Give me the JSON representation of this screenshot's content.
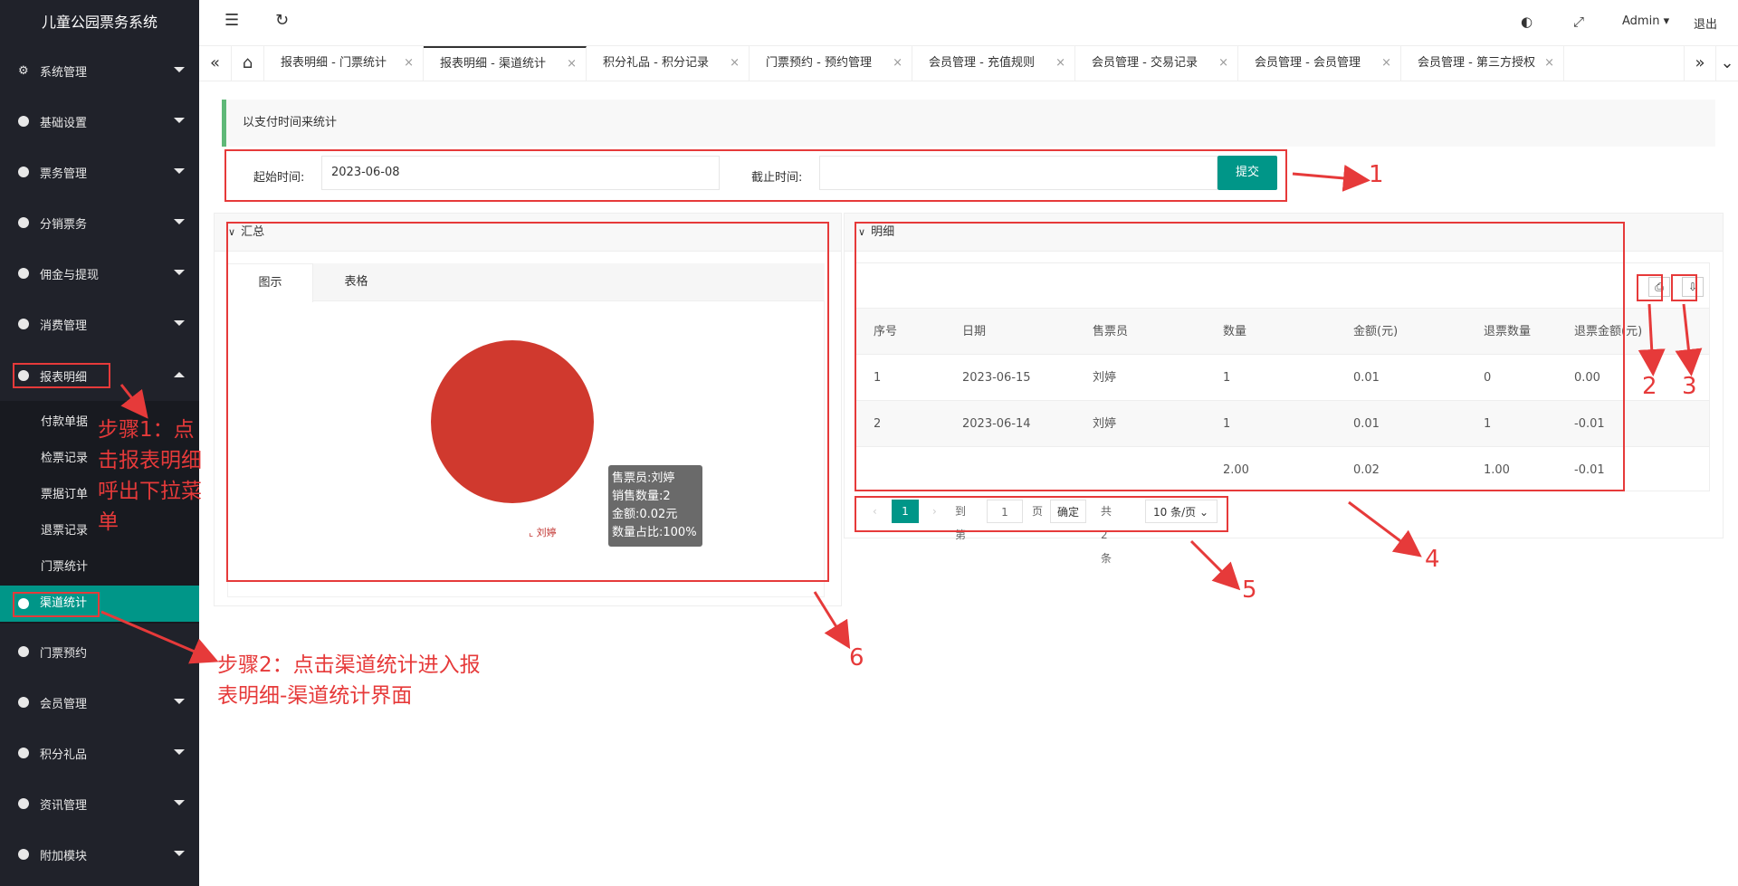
{
  "app": {
    "title": "儿童公园票务系统"
  },
  "sidebar": {
    "items": [
      {
        "label": "系统管理"
      },
      {
        "label": "基础设置"
      },
      {
        "label": "票务管理"
      },
      {
        "label": "分销票务"
      },
      {
        "label": "佣金与提现"
      },
      {
        "label": "消费管理"
      },
      {
        "label": "报表明细"
      },
      {
        "label": "门票预约"
      },
      {
        "label": "会员管理"
      },
      {
        "label": "积分礼品"
      },
      {
        "label": "资讯管理"
      },
      {
        "label": "附加模块"
      }
    ],
    "submenu": [
      {
        "label": "付款单据"
      },
      {
        "label": "检票记录"
      },
      {
        "label": "票据订单"
      },
      {
        "label": "退票记录"
      },
      {
        "label": "门票统计"
      },
      {
        "label": "渠道统计"
      }
    ]
  },
  "header": {
    "user": "Admin",
    "logout": "退出"
  },
  "tabs": [
    {
      "label": "报表明细 - 门票统计"
    },
    {
      "label": "报表明细 - 渠道统计"
    },
    {
      "label": "积分礼品 - 积分记录"
    },
    {
      "label": "门票预约 - 预约管理"
    },
    {
      "label": "会员管理 - 充值规则"
    },
    {
      "label": "会员管理 - 交易记录"
    },
    {
      "label": "会员管理 - 会员管理"
    },
    {
      "label": "会员管理 - 第三方授权"
    }
  ],
  "notice": "以支付时间来统计",
  "form": {
    "start_label": "起始时间:",
    "start_value": "2023-06-08",
    "end_label": "截止时间:",
    "end_value": "",
    "submit": "提交"
  },
  "summary_panel": {
    "title": "汇总",
    "tab_chart": "图示",
    "tab_table": "表格"
  },
  "chart_data": {
    "type": "pie",
    "slices": [
      {
        "name": "刘婷",
        "value": 2
      }
    ],
    "tooltip": [
      "售票员:刘婷",
      "销售数量:2",
      "金额:0.02元",
      "数量占比:100%"
    ],
    "colors": [
      "#d0392e"
    ]
  },
  "detail_panel": {
    "title": "明细",
    "columns": [
      "序号",
      "日期",
      "售票员",
      "数量",
      "金额(元)",
      "退票数量",
      "退票金额(元)"
    ],
    "rows": [
      [
        "1",
        "2023-06-15",
        "刘婷",
        "1",
        "0.01",
        "0",
        "0.00"
      ],
      [
        "2",
        "2023-06-14",
        "刘婷",
        "1",
        "0.01",
        "1",
        "-0.01"
      ]
    ],
    "totals": [
      "",
      "",
      "",
      "2.00",
      "0.02",
      "1.00",
      "-0.01"
    ]
  },
  "pager": {
    "current": "1",
    "goto_label": "到第",
    "page_input": "1",
    "page_unit": "页",
    "confirm": "确定",
    "total": "共 2 条",
    "page_size": "10 条/页"
  },
  "annotations": {
    "n1": "1",
    "n2": "2",
    "n3": "3",
    "n4": "4",
    "n5": "5",
    "n6": "6",
    "step1": "步骤1：点击报表明细呼出下拉菜单",
    "step2": "步骤2：点击渠道统计进入报表明细-渠道统计界面"
  },
  "colors": {
    "accent": "#009688",
    "sidebar": "#20222a",
    "annotation": "#e63a3a",
    "pie": "#d0392e"
  }
}
